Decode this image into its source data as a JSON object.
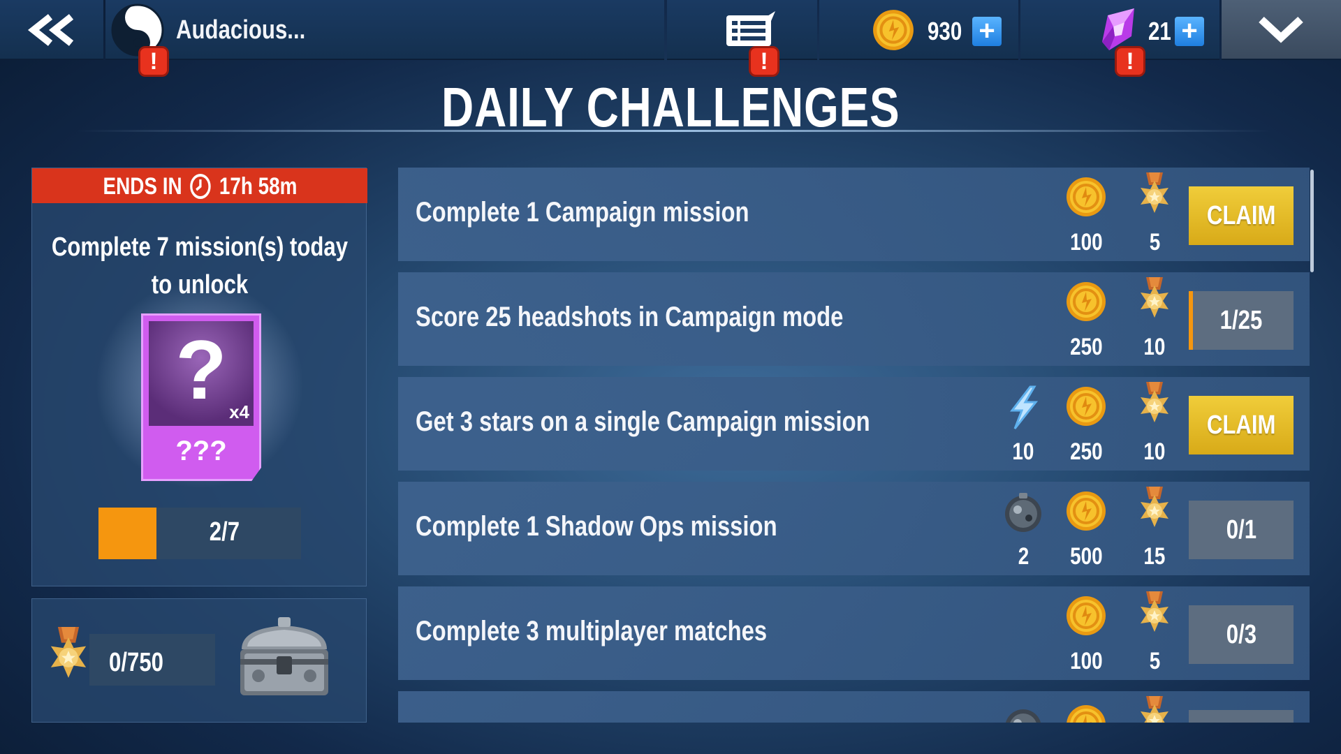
{
  "topbar": {
    "player_name": "Audacious...",
    "coins": "930",
    "gems": "21",
    "plus_label": "+",
    "alert_label": "!"
  },
  "title": "DAILY CHALLENGES",
  "daily_chest": {
    "ends_prefix": "ENDS IN",
    "ends_time": "17h 58m",
    "unlock_text": "Complete 7 mission(s) today to unlock",
    "reward_name": "???",
    "reward_count": "x4",
    "question_mark": "?",
    "progress_text": "2/7",
    "progress_fraction": 0.2857
  },
  "medal_progress": {
    "text": "0/750"
  },
  "challenges": [
    {
      "text": "Complete 1 Campaign mission",
      "coins": "100",
      "medals": "5",
      "status": "CLAIM"
    },
    {
      "text": "Score 25 headshots in Campaign mode",
      "coins": "250",
      "medals": "10",
      "status": "1/25"
    },
    {
      "text": "Get 3 stars on a single Campaign mission",
      "energy": "10",
      "coins": "250",
      "medals": "10",
      "status": "CLAIM"
    },
    {
      "text": "Complete 1 Shadow Ops mission",
      "item": "2",
      "coins": "500",
      "medals": "15",
      "status": "0/1"
    },
    {
      "text": "Complete 3 multiplayer matches",
      "coins": "100",
      "medals": "5",
      "status": "0/3"
    }
  ],
  "colors": {
    "accent_orange": "#f5960f",
    "banner_red": "#d9341c",
    "claim_yellow": "#e6bd28",
    "mystery_purple": "#d05cef",
    "plus_blue": "#2f8ff0"
  },
  "icons": {
    "back": "double-chevron-left-icon",
    "avatar": "yin-yang-icon",
    "news": "news-list-icon",
    "coin": "gold-coin-icon",
    "gem": "purple-gem-icon",
    "menu": "chevron-down-icon",
    "medal": "medal-star-icon",
    "energy": "lightning-icon",
    "item": "grenade-orb-icon",
    "chest": "metal-chest-icon",
    "clock": "clock-icon"
  }
}
